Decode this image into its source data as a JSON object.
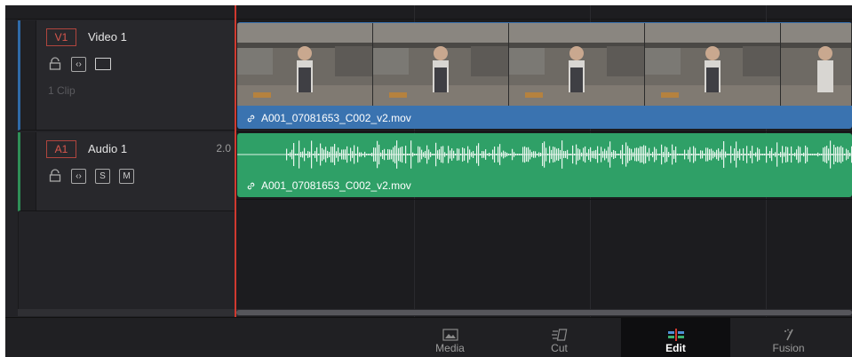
{
  "tracks": {
    "video": {
      "badge": "V1",
      "name": "Video 1",
      "clip_count": "1 Clip"
    },
    "audio": {
      "badge": "A1",
      "name": "Audio 1",
      "channels": "2.0",
      "solo_label": "S",
      "mute_label": "M"
    }
  },
  "clips": {
    "video": {
      "filename": "A001_07081653_C002_v2.mov",
      "color": "#3a73b0"
    },
    "audio": {
      "filename": "A001_07081653_C002_v2.mov",
      "color": "#2fa067"
    }
  },
  "page_tabs": [
    {
      "label": "Media",
      "icon": "media-page-icon",
      "active": false
    },
    {
      "label": "Cut",
      "icon": "cut-page-icon",
      "active": false
    },
    {
      "label": "Edit",
      "icon": "edit-page-icon",
      "active": true
    },
    {
      "label": "Fusion",
      "icon": "fusion-page-icon",
      "active": false
    }
  ],
  "colors": {
    "playhead": "#d0392f",
    "track_badge": "#d9574d",
    "active_tab_icon": "#d0392f"
  }
}
